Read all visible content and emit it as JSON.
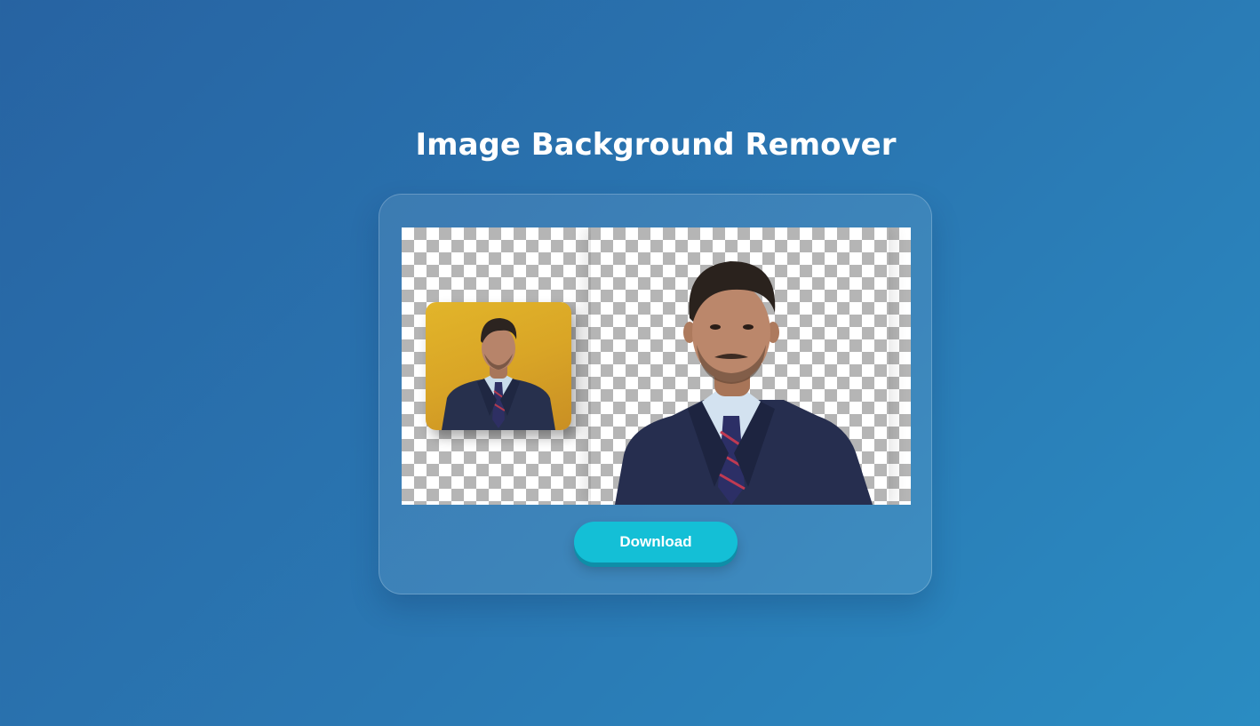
{
  "page": {
    "title": "Image Background Remover"
  },
  "colors": {
    "background_start": "#2763a2",
    "background_end": "#2a8cc2",
    "button": "#14bfd6",
    "thumbnail_bg": "#d9a526"
  },
  "preview": {
    "original_thumbnail_icon": "person-portrait-yellow-background",
    "result_icon": "person-portrait-transparent-background",
    "transparency_pattern": "checkerboard"
  },
  "actions": {
    "download_label": "Download"
  }
}
